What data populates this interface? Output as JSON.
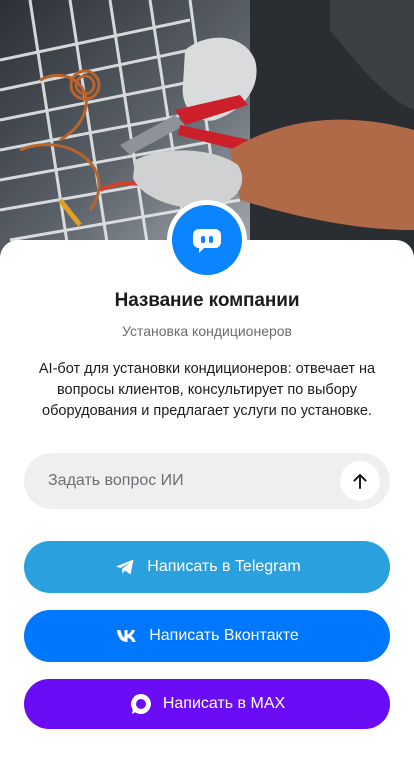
{
  "company": {
    "name": "Название компании",
    "subtitle": "Установка кондиционеров",
    "description": "AI-бот для установки кондиционеров: отвечает на вопросы клиентов, консультирует по выбору оборудования и предлагает услуги по установке."
  },
  "ask": {
    "placeholder": "Задать вопрос ИИ",
    "value": ""
  },
  "buttons": {
    "telegram": "Написать в Telegram",
    "vk": "Написать Вконтакте",
    "max": "Написать в MAX"
  },
  "icons": {
    "avatar": "chat-bot-icon",
    "send": "arrow-up-icon",
    "telegram": "telegram-icon",
    "vk": "vk-icon",
    "max": "max-icon"
  },
  "colors": {
    "avatar": "#0a84ff",
    "telegram": "#2aa0de",
    "vk": "#0077ff",
    "max": "#6a0cf5",
    "input_bg": "#efefef"
  }
}
